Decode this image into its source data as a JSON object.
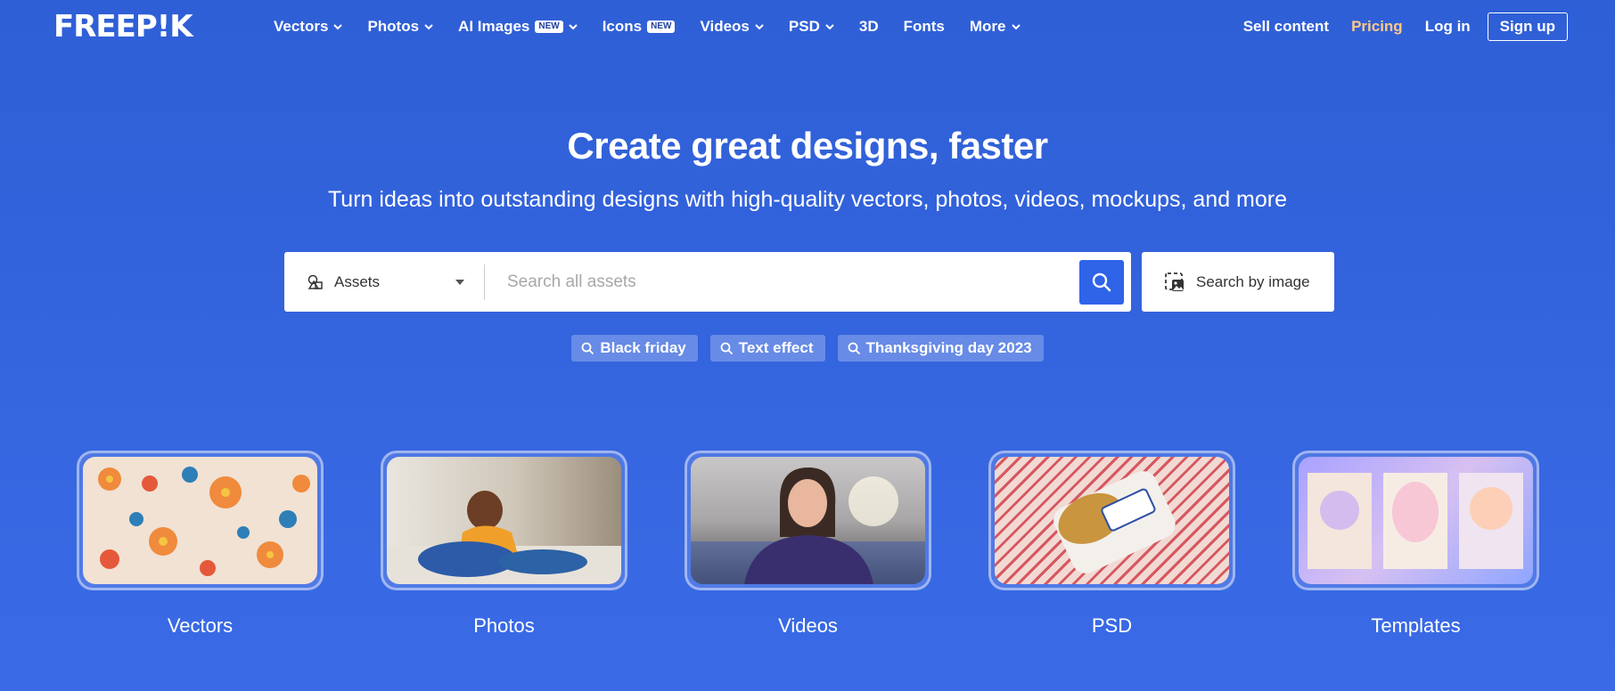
{
  "header": {
    "logo": "FREEP!K",
    "nav": [
      {
        "label": "Vectors",
        "dropdown": true
      },
      {
        "label": "Photos",
        "dropdown": true
      },
      {
        "label": "AI Images",
        "badge": "NEW",
        "dropdown": true
      },
      {
        "label": "Icons",
        "badge": "NEW",
        "dropdown": false
      },
      {
        "label": "Videos",
        "dropdown": true
      },
      {
        "label": "PSD",
        "dropdown": true
      },
      {
        "label": "3D",
        "dropdown": false
      },
      {
        "label": "Fonts",
        "dropdown": false
      },
      {
        "label": "More",
        "dropdown": true
      }
    ],
    "right": {
      "sell": "Sell content",
      "pricing": "Pricing",
      "login": "Log in",
      "signup": "Sign up"
    }
  },
  "hero": {
    "title": "Create great designs, faster",
    "subtitle": "Turn ideas into outstanding designs with high-quality vectors, photos, videos, mockups, and more"
  },
  "search": {
    "asset_type": "Assets",
    "placeholder": "Search all assets",
    "image_search_label": "Search by image"
  },
  "tags": [
    "Black friday",
    "Text effect",
    "Thanksgiving day 2023"
  ],
  "categories": [
    {
      "label": "Vectors"
    },
    {
      "label": "Photos"
    },
    {
      "label": "Videos"
    },
    {
      "label": "PSD"
    },
    {
      "label": "Templates"
    }
  ],
  "colors": {
    "background": "#3163de",
    "pricing_accent": "#ffc98a",
    "search_button": "#2f63e8"
  }
}
